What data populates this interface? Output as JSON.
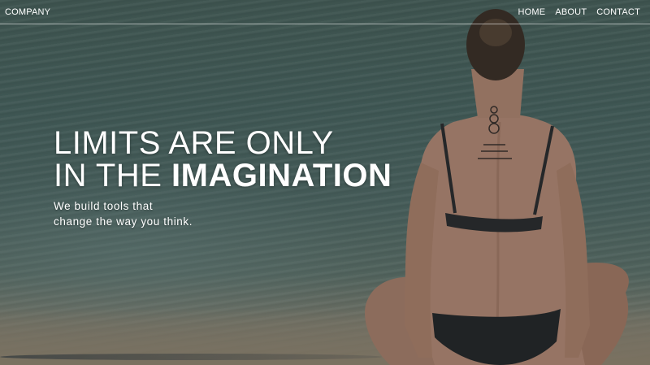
{
  "nav": {
    "brand": "COMPANY",
    "items": [
      {
        "label": "HOME"
      },
      {
        "label": "ABOUT"
      },
      {
        "label": "CONTACT"
      }
    ]
  },
  "hero": {
    "headline_line1": "LIMITS ARE ONLY",
    "headline_line2_prefix": "IN THE ",
    "headline_line2_emphasis": "IMAGINATION",
    "subtitle_line1": "We build tools that",
    "subtitle_line2": "change the way you think."
  }
}
